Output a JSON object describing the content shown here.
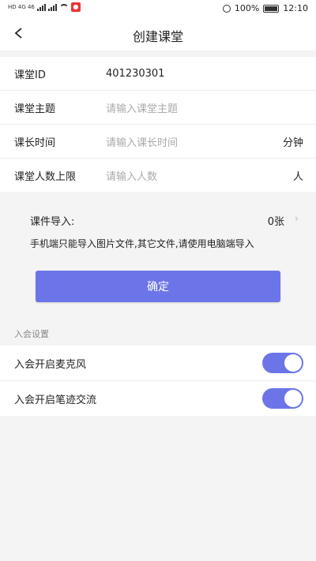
{
  "status_bar": {
    "left_text": "HD 4G 46",
    "alarm_icon": "alarm-icon",
    "battery": "100%",
    "time": "12:10"
  },
  "header": {
    "title": "创建课堂",
    "back_icon": "chevron-left-icon"
  },
  "form": {
    "rows": [
      {
        "label": "课堂ID",
        "value": "401230301"
      },
      {
        "label": "课堂主题",
        "placeholder": "请输入课堂主题"
      },
      {
        "label": "课长时间",
        "placeholder": "请输入课长时间",
        "unit": "分钟"
      },
      {
        "label": "课堂人数上限",
        "placeholder": "请输入人数",
        "unit": "人"
      }
    ]
  },
  "import": {
    "label": "课件导入:",
    "count": "0张",
    "chevron": "›",
    "note": "手机端只能导入图片文件,其它文件,请使用电脑端导入"
  },
  "confirm_label": "确定",
  "settings": {
    "section_title": "入会设置",
    "items": [
      {
        "label": "入会开启麦克风",
        "enabled": true
      },
      {
        "label": "入会开启笔迹交流",
        "enabled": true
      }
    ]
  },
  "colors": {
    "accent": "#6c75e8",
    "background": "#f4f4f4"
  }
}
